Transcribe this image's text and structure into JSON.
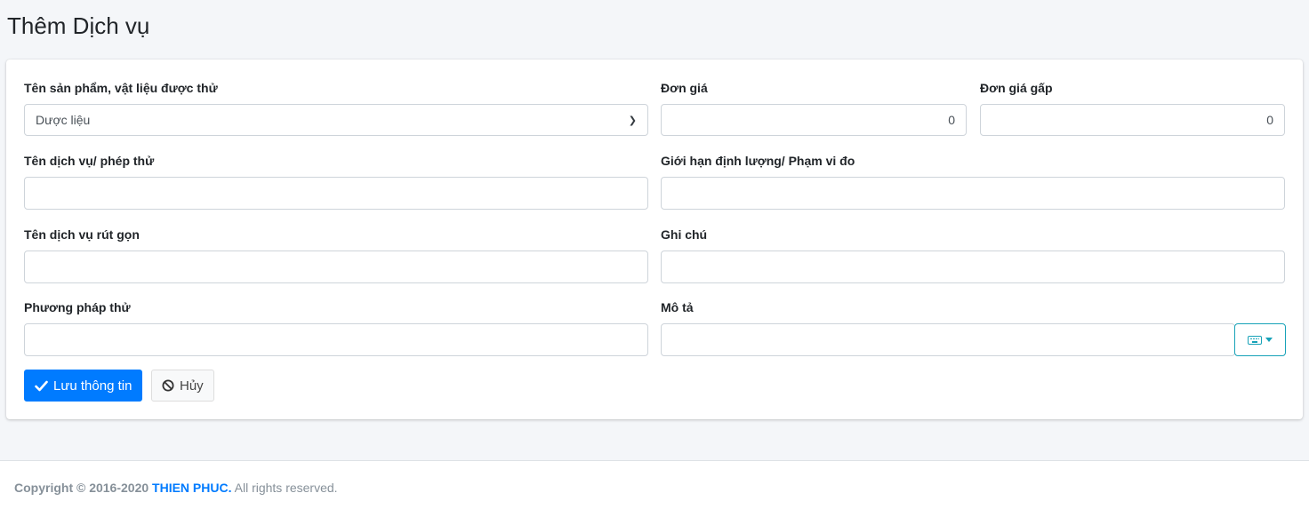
{
  "page": {
    "title": "Thêm Dịch vụ"
  },
  "form": {
    "product": {
      "label": "Tên sản phẩm, vật liệu được thử",
      "selected": "Dược liệu"
    },
    "price": {
      "label": "Đơn giá",
      "value": "0"
    },
    "urgent_price": {
      "label": "Đơn giá gấp",
      "value": "0"
    },
    "service_name": {
      "label": "Tên dịch vụ/ phép thử",
      "value": ""
    },
    "limit": {
      "label": "Giới hạn định lượng/ Phạm vi đo",
      "value": ""
    },
    "short_name": {
      "label": "Tên dịch vụ rút gọn",
      "value": ""
    },
    "note": {
      "label": "Ghi chú",
      "value": ""
    },
    "method": {
      "label": "Phương pháp thử",
      "value": ""
    },
    "description": {
      "label": "Mô tả",
      "value": "",
      "keyboard_icon": "keyboard-icon"
    }
  },
  "buttons": {
    "save": {
      "label": "Lưu thông tin",
      "icon": "check-icon"
    },
    "cancel": {
      "label": "Hủy",
      "icon": "ban-icon"
    }
  },
  "footer": {
    "prefix": "Copyright © 2016-2020",
    "company": "THIEN PHUC.",
    "suffix": "All rights reserved."
  },
  "colors": {
    "primary": "#007bff",
    "info": "#17a2b8",
    "background": "#f4f6f9"
  }
}
